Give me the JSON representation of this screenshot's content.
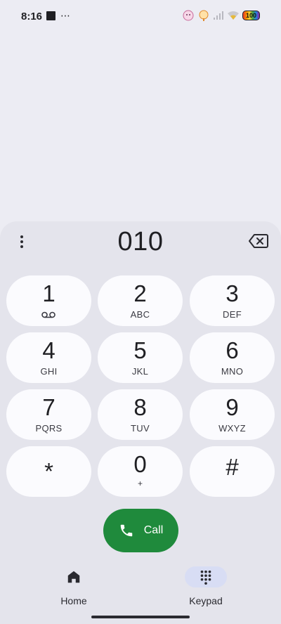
{
  "status_bar": {
    "time": "8:16",
    "left_icons": [
      "stop-icon",
      "more-dots-icon"
    ],
    "right_icons": [
      "sticker-icon",
      "sticker-icon",
      "signal-icon",
      "wifi-icon",
      "battery-icon"
    ],
    "battery_level": "100"
  },
  "dialer": {
    "number": "010",
    "more_icon": "more-vert-icon",
    "backspace_icon": "backspace-icon"
  },
  "keypad": {
    "keys": [
      {
        "digit": "1",
        "letters": "",
        "icon": "voicemail-icon"
      },
      {
        "digit": "2",
        "letters": "ABC"
      },
      {
        "digit": "3",
        "letters": "DEF"
      },
      {
        "digit": "4",
        "letters": "GHI"
      },
      {
        "digit": "5",
        "letters": "JKL"
      },
      {
        "digit": "6",
        "letters": "MNO"
      },
      {
        "digit": "7",
        "letters": "PQRS"
      },
      {
        "digit": "8",
        "letters": "TUV"
      },
      {
        "digit": "9",
        "letters": "WXYZ"
      },
      {
        "digit": "*",
        "letters": ""
      },
      {
        "digit": "0",
        "letters": "+"
      },
      {
        "digit": "#",
        "letters": ""
      }
    ]
  },
  "call_button": {
    "label": "Call",
    "icon": "phone-icon",
    "color": "#1F8A3C"
  },
  "bottom_nav": {
    "items": [
      {
        "label": "Home",
        "icon": "home-icon",
        "active": false
      },
      {
        "label": "Keypad",
        "icon": "dialpad-icon",
        "active": true
      }
    ]
  },
  "colors": {
    "background": "#ECECF3",
    "key": "#FBFBFE",
    "accent_pill": "#D8DDF4"
  }
}
